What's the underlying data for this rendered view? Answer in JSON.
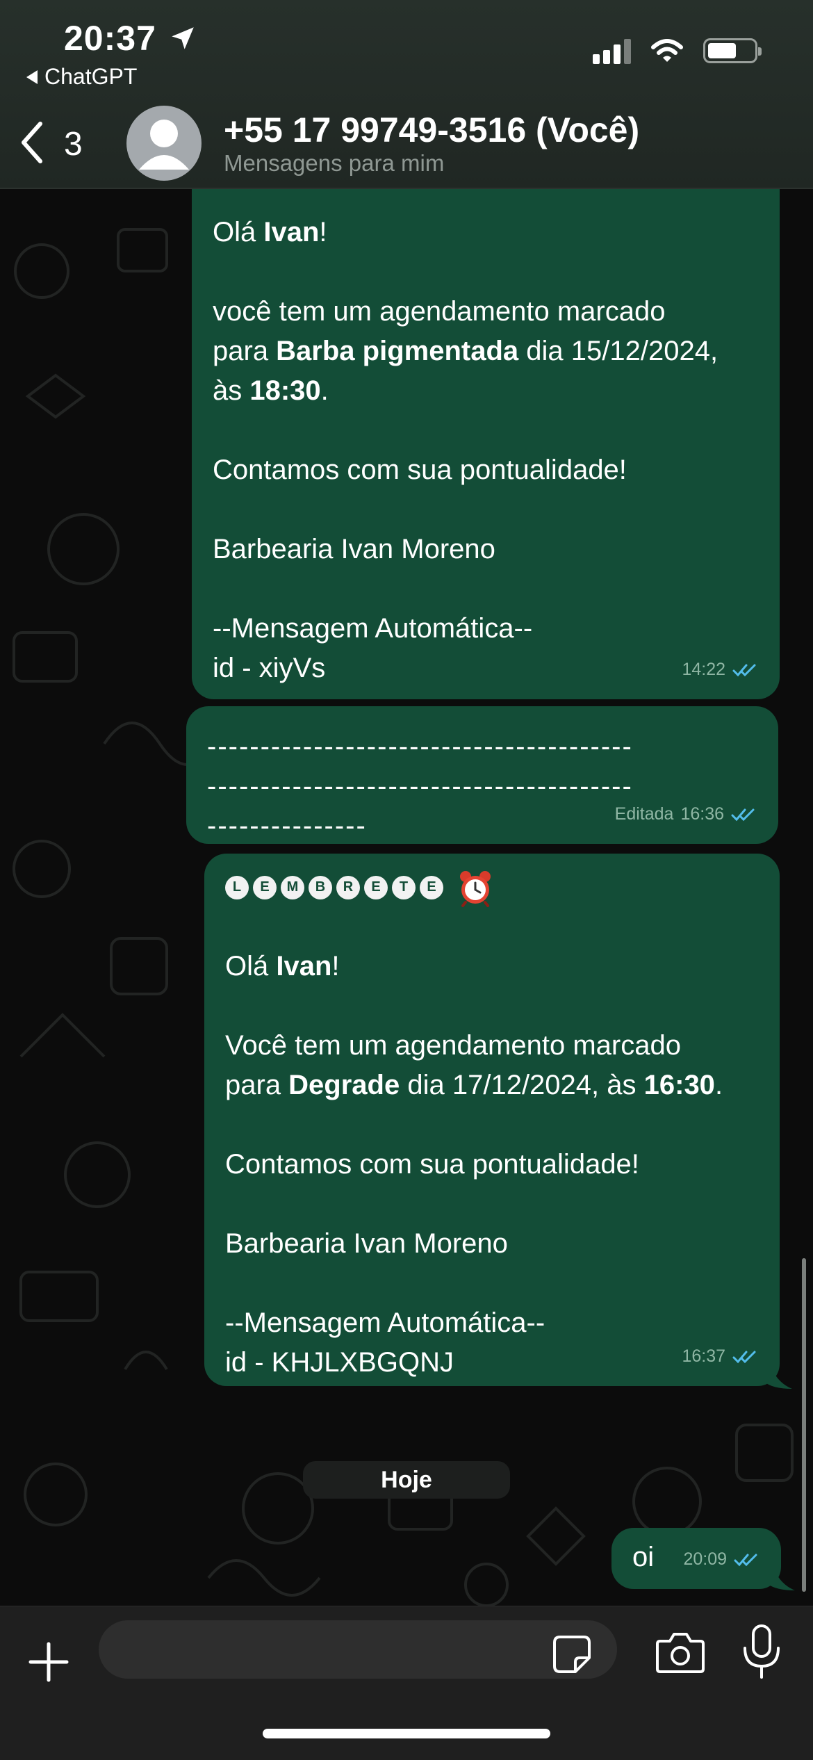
{
  "status_bar": {
    "time": "20:37",
    "back_app": "ChatGPT"
  },
  "header": {
    "back_count": "3",
    "contact_name": "+55 17 99749-3516 (Você)",
    "contact_subtitle": "Mensagens para mim"
  },
  "messages": [
    {
      "lines": [
        [
          "Olá ",
          {
            "b": "Ivan"
          },
          "!"
        ],
        [],
        [
          "você tem um agendamento marcado"
        ],
        [
          "para ",
          {
            "b": "Barba pigmentada"
          },
          " dia 15/12/2024,"
        ],
        [
          "às ",
          {
            "b": "18:30"
          },
          "."
        ],
        [],
        [
          "Contamos com sua pontualidade!"
        ],
        [],
        [
          "Barbearia Ivan Moreno"
        ],
        [],
        [
          "--Mensagem Automática--"
        ],
        [
          "id - xiyVs"
        ]
      ],
      "time": "14:22"
    },
    {
      "lines": [
        "----------------------------------------",
        "----------------------------------------",
        "---------------"
      ],
      "edited_label": "Editada",
      "time": "16:36"
    },
    {
      "heading_letters": [
        "L",
        "E",
        "M",
        "B",
        "R",
        "E",
        "T",
        "E"
      ],
      "lines": [
        [],
        [
          "Olá ",
          {
            "b": "Ivan"
          },
          "!"
        ],
        [],
        [
          "Você tem um agendamento marcado"
        ],
        [
          "para ",
          {
            "b": "Degrade"
          },
          " dia 17/12/2024, às ",
          {
            "b": "16:30"
          },
          "."
        ],
        [],
        [
          "Contamos com sua pontualidade!"
        ],
        [],
        [
          "Barbearia Ivan Moreno"
        ],
        [],
        [
          "--Mensagem Automática--"
        ],
        [
          "id - KHJLXBGQNJ"
        ]
      ],
      "time": "16:37"
    },
    {
      "text": "oi",
      "time": "20:09"
    }
  ],
  "day_separator": "Hoje",
  "colors": {
    "bubble_outgoing": "#134d37",
    "read_ticks": "#53bdeb",
    "header_bg": "#202723",
    "input_bar_bg": "#1f1f1f"
  },
  "icons": [
    "location-arrow-icon",
    "signal-icon",
    "wifi-icon",
    "battery-icon",
    "back-chevron-icon",
    "avatar-icon",
    "double-check-icon",
    "alarm-clock-icon",
    "plus-icon",
    "sticker-icon",
    "camera-icon",
    "microphone-icon"
  ]
}
